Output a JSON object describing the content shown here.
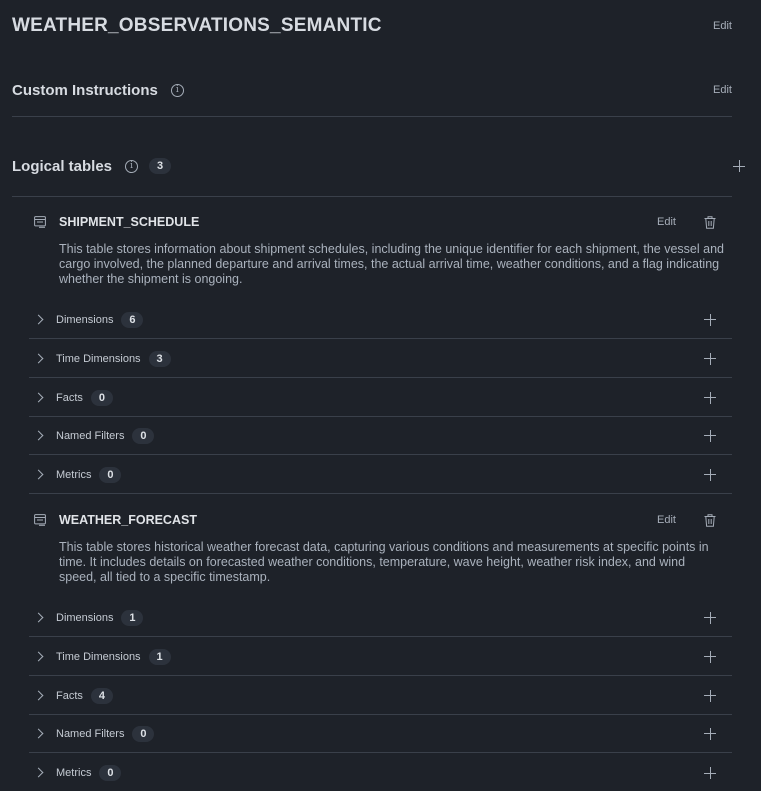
{
  "header": {
    "title": "WEATHER_OBSERVATIONS_SEMANTIC",
    "edit_label": "Edit"
  },
  "custom_instructions": {
    "title": "Custom Instructions",
    "edit_label": "Edit"
  },
  "logical_tables": {
    "title": "Logical tables",
    "count": "3",
    "tables": [
      {
        "name": "SHIPMENT_SCHEDULE",
        "edit_label": "Edit",
        "description": "This table stores information about shipment schedules, including the unique identifier for each shipment, the vessel and cargo involved, the planned departure and arrival times, the actual arrival time, weather conditions, and a flag indicating whether the shipment is ongoing.",
        "sections": [
          {
            "label": "Dimensions",
            "count": "6"
          },
          {
            "label": "Time Dimensions",
            "count": "3"
          },
          {
            "label": "Facts",
            "count": "0"
          },
          {
            "label": "Named Filters",
            "count": "0"
          },
          {
            "label": "Metrics",
            "count": "0"
          }
        ]
      },
      {
        "name": "WEATHER_FORECAST",
        "edit_label": "Edit",
        "description": "This table stores historical weather forecast data, capturing various conditions and measurements at specific points in time. It includes details on forecasted weather conditions, temperature, wave height, weather risk index, and wind speed, all tied to a specific timestamp.",
        "sections": [
          {
            "label": "Dimensions",
            "count": "1"
          },
          {
            "label": "Time Dimensions",
            "count": "1"
          },
          {
            "label": "Facts",
            "count": "4"
          },
          {
            "label": "Named Filters",
            "count": "0"
          },
          {
            "label": "Metrics",
            "count": "0"
          }
        ]
      }
    ]
  },
  "icons": {
    "info": "info-icon",
    "add": "plus-icon",
    "expand": "chevron-right-icon",
    "table": "table-icon",
    "delete": "trash-icon"
  }
}
